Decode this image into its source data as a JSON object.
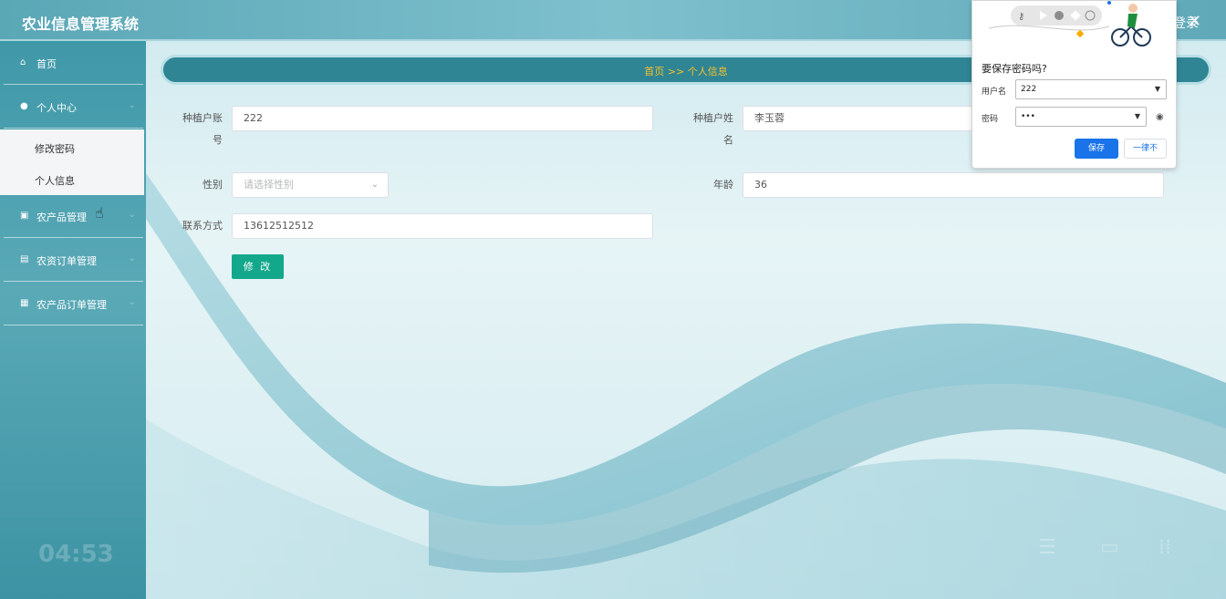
{
  "header": {
    "app_title": "农业信息管理系统",
    "right_text": "登录",
    "close_glyph": "✕"
  },
  "sidebar": {
    "items": [
      {
        "label": "首页",
        "icon": "home-icon",
        "glyph": "⌂"
      },
      {
        "label": "个人中心",
        "icon": "user-icon",
        "glyph": "●",
        "chevron": "⌄"
      },
      {
        "label": "农产品管理",
        "icon": "chart-icon",
        "glyph": "▣",
        "chevron": "⌄"
      },
      {
        "label": "农资订单管理",
        "icon": "briefcase-icon",
        "glyph": "▤",
        "chevron": "⌄"
      },
      {
        "label": "农产品订单管理",
        "icon": "grid-icon",
        "glyph": "▦",
        "chevron": "⌄"
      }
    ],
    "submenu": [
      {
        "label": "修改密码"
      },
      {
        "label": "个人信息"
      }
    ],
    "timer": "04:53"
  },
  "breadcrumb": {
    "text": "首页 >> 个人信息"
  },
  "form": {
    "account": {
      "label_line1": "种植户账",
      "label_line2": "号",
      "value": "222"
    },
    "name": {
      "label_line1": "种植户姓",
      "label_line2": "名",
      "value": "李玉蓉"
    },
    "gender": {
      "label": "性别",
      "placeholder": "请选择性别"
    },
    "age": {
      "label": "年龄",
      "value": "36"
    },
    "contact": {
      "label": "联系方式",
      "value": "13612512512"
    },
    "submit_label": "修 改"
  },
  "password_popup": {
    "title": "要保存密码吗?",
    "username_label": "用户名",
    "username_value": "222",
    "password_label": "密码",
    "password_value": "•••",
    "save_label": "保存",
    "never_label": "一律不"
  },
  "colors": {
    "accent": "#2f8594",
    "breadcrumb_text": "#f5c12a",
    "submit": "#13a88b",
    "popup_blue": "#1a73e8"
  }
}
